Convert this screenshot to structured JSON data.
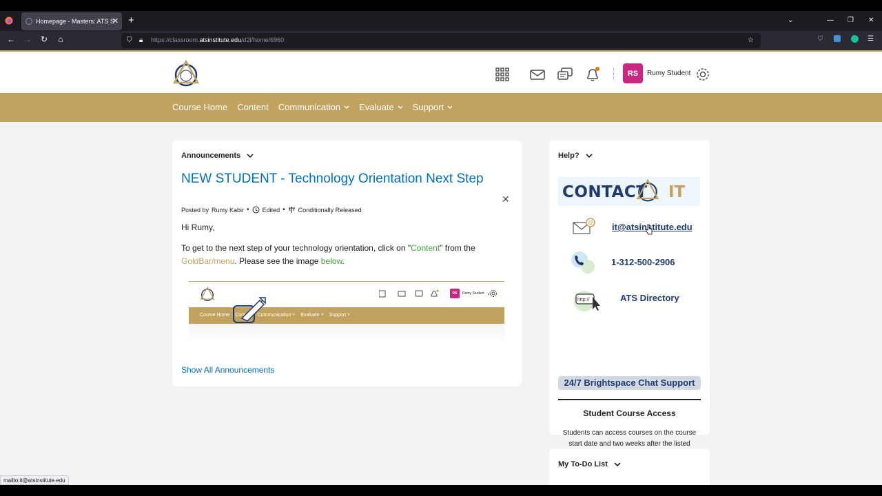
{
  "browser": {
    "tab_title": "Homepage - Masters: ATS Studi",
    "url_host_prefix": "https://classroom.",
    "url_host": "atsinstitute.edu",
    "url_path": "/d2l/home/6960",
    "status_link": "mailto:it@atsinstitute.edu"
  },
  "header": {
    "avatar_initials": "RS",
    "user_name": "Rumy Student"
  },
  "nav": {
    "items": [
      {
        "label": "Course Home"
      },
      {
        "label": "Content"
      },
      {
        "label": "Communication"
      },
      {
        "label": "Evaluate"
      },
      {
        "label": "Support"
      }
    ]
  },
  "announcements": {
    "widget_title": "Announcements",
    "headline": "NEW STUDENT - Technology Orientation Next Step",
    "posted_by_label": "Posted by",
    "author": "Rumy Kabir",
    "edited_label": "Edited",
    "release_label": "Conditionally Released",
    "greeting": "Hi Rumy,",
    "body_part1": "To get to the next step of your technology orientation, click on \"",
    "body_content_word": "Content",
    "body_part2": "\" from the ",
    "body_goldbar": "GoldBar/menu",
    "body_part3": ". Please see the image ",
    "body_below": "below",
    "body_part4": ".",
    "preview_menu": [
      "Course Home",
      "Content",
      "Communication ˅",
      "Evaluate ˅",
      "Support ˅"
    ],
    "preview_user": "Rumy Student",
    "preview_avatar": "RS",
    "show_all": "Show All Announcements"
  },
  "help": {
    "widget_title": "Help?",
    "banner_left": "CONTACT",
    "banner_right": "IT",
    "email": "it@atsinstitute.edu",
    "phone": "1-312-500-2906",
    "directory": "ATS Directory",
    "chat_support": "24/7 Brightspace Chat Support",
    "access_title": "Student Course Access",
    "access_text": "Students can access courses on the course start date and two weeks after the listed course end date."
  },
  "todo": {
    "widget_title": "My To-Do List"
  },
  "colors": {
    "gold": "#c1a35f",
    "link_blue": "#006fbf",
    "avatar_magenta": "#c72882",
    "navy": "#1e3a6e",
    "green_link": "#3da13a"
  }
}
